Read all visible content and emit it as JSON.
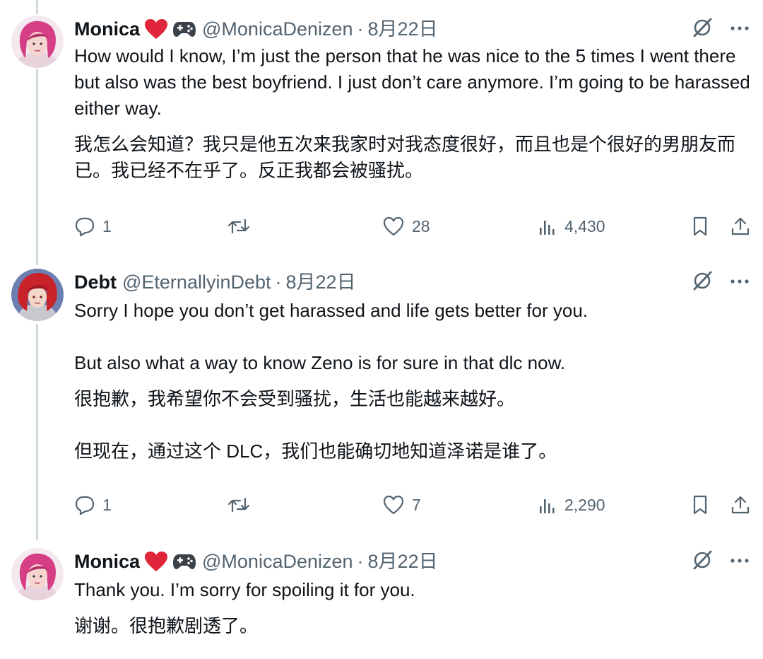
{
  "tweets": [
    {
      "author": {
        "name": "Monica",
        "emoji_icons": [
          "red-heart-icon",
          "game-controller-icon"
        ],
        "handle": "@MonicaDenizen",
        "date": "8月22日"
      },
      "text_en": "How would I know, I’m just the person that he was nice to the 5 times I went there but also was the best boyfriend. I just don’t care anymore. I’m going to be harassed either way.",
      "text_zh": "我怎么会知道？我只是他五次来我家时对我态度很好，而且也是个很好的男朋友而已。我已经不在乎了。反正我都会被骚扰。",
      "stats": {
        "replies": "1",
        "likes": "28",
        "views": "4,430"
      }
    },
    {
      "author": {
        "name": "Debt",
        "emoji_icons": [],
        "handle": "@EternallyinDebt",
        "date": "8月22日"
      },
      "text_en": "Sorry I hope you don’t get harassed and life gets better for you.\n\nBut also what a way to know Zeno is for sure in that dlc now.",
      "text_zh": "很抱歉，我希望你不会受到骚扰，生活也能越来越好。\n\n但现在，通过这个 DLC，我们也能确切地知道泽诺是谁了。",
      "stats": {
        "replies": "1",
        "likes": "7",
        "views": "2,290"
      }
    },
    {
      "author": {
        "name": "Monica",
        "emoji_icons": [
          "red-heart-icon",
          "game-controller-icon"
        ],
        "handle": "@MonicaDenizen",
        "date": "8月22日"
      },
      "text_en": "Thank you. I’m sorry for spoiling it for you.",
      "text_zh": "谢谢。很抱歉剧透了。"
    }
  ],
  "separator": "·",
  "colors": {
    "text_primary": "#0f1419",
    "text_secondary": "#536471",
    "thread_line": "#cfd9de",
    "heart_emoji": "#e0243a"
  },
  "icons": {
    "header_right": [
      "grok-slash-icon",
      "more-icon"
    ],
    "actions": [
      "reply-icon",
      "retweet-icon",
      "like-icon",
      "views-icon",
      "bookmark-icon",
      "share-icon"
    ]
  }
}
